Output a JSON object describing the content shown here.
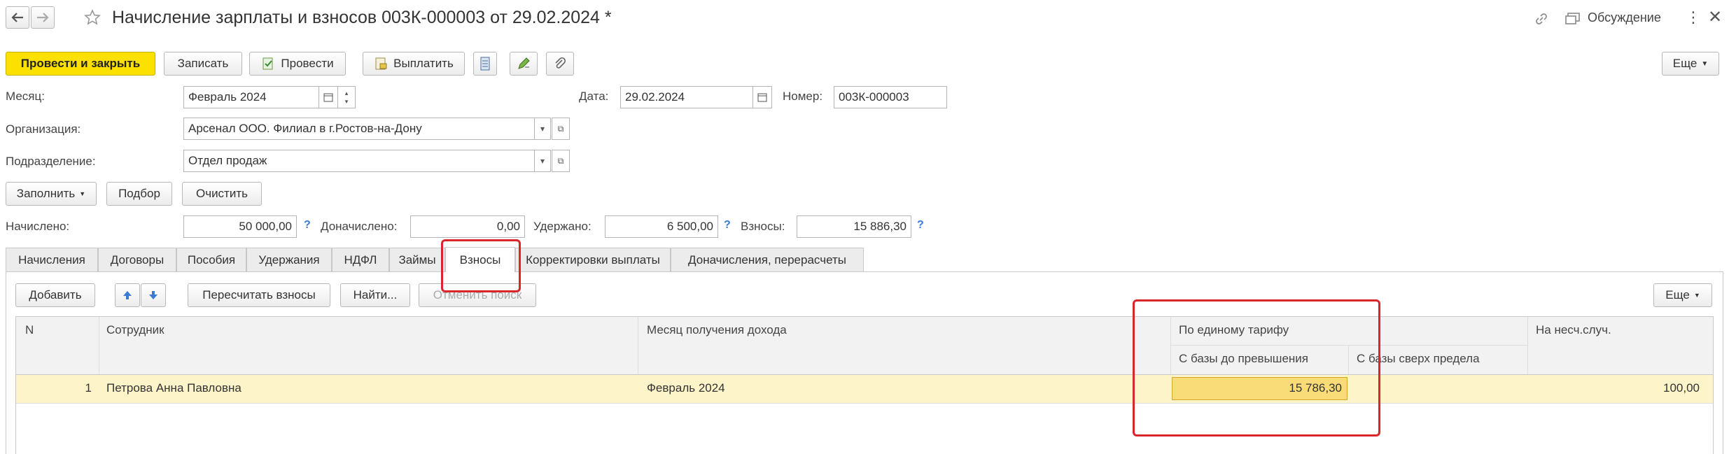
{
  "window": {
    "title": "Начисление зарплаты и взносов 003К-000003 от 29.02.2024 *",
    "discussion_label": "Обсуждение"
  },
  "toolbar": {
    "post_close": "Провести и закрыть",
    "save": "Записать",
    "post": "Провести",
    "pay": "Выплатить",
    "more": "Еще"
  },
  "form": {
    "month_label": "Месяц:",
    "month_value": "Февраль 2024",
    "date_label": "Дата:",
    "date_value": "29.02.2024",
    "number_label": "Номер:",
    "number_value": "003К-000003",
    "org_label": "Организация:",
    "org_value": "Арсенал ООО. Филиал в г.Ростов-на-Дону",
    "dept_label": "Подразделение:",
    "dept_value": "Отдел продаж",
    "fill_button": "Заполнить",
    "pick_button": "Подбор",
    "clear_button": "Очистить",
    "accrued_label": "Начислено:",
    "accrued_value": "50 000,00",
    "extra_label": "Доначислено:",
    "extra_value": "0,00",
    "withheld_label": "Удержано:",
    "withheld_value": "6 500,00",
    "contrib_label": "Взносы:",
    "contrib_value": "15 886,30",
    "help": "?"
  },
  "tabs": [
    {
      "label": "Начисления"
    },
    {
      "label": "Договоры"
    },
    {
      "label": "Пособия"
    },
    {
      "label": "Удержания"
    },
    {
      "label": "НДФЛ"
    },
    {
      "label": "Займы"
    },
    {
      "label": "Взносы"
    },
    {
      "label": "Корректировки выплаты"
    },
    {
      "label": "Доначисления, перерасчеты"
    }
  ],
  "table_toolbar": {
    "add": "Добавить",
    "recalc": "Пересчитать взносы",
    "find": "Найти...",
    "cancel_search": "Отменить поиск",
    "more": "Еще"
  },
  "table": {
    "headers": {
      "n": "N",
      "employee": "Сотрудник",
      "month": "Месяц получения дохода",
      "single_tariff": "По единому тарифу",
      "base_below": "С базы до превышения",
      "base_above": "С базы сверх предела",
      "accident": "На несч.случ."
    },
    "rows": [
      {
        "n": "1",
        "employee": "Петрова Анна Павловна",
        "month": "Февраль 2024",
        "base_below": "15 786,30",
        "base_above": "",
        "accident": "100,00"
      }
    ]
  },
  "colors": {
    "primary_button": "#fbe000",
    "selected_row": "#fdf5c9",
    "selected_cell": "#f9dc77",
    "highlight": "#d9262c",
    "help": "#3a7bd5"
  }
}
